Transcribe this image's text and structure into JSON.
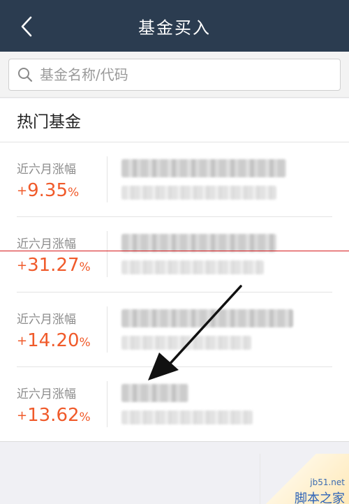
{
  "header": {
    "title": "基金买入",
    "back_icon": "chevron-left-icon"
  },
  "search": {
    "placeholder": "基金名称/代码",
    "value": "",
    "icon": "search-icon"
  },
  "section": {
    "title": "热门基金"
  },
  "funds": [
    {
      "label": "近六月涨幅",
      "sign": "+",
      "value": "9.35",
      "unit": "%"
    },
    {
      "label": "近六月涨幅",
      "sign": "+",
      "value": "31.27",
      "unit": "%"
    },
    {
      "label": "近六月涨幅",
      "sign": "+",
      "value": "14.20",
      "unit": "%"
    },
    {
      "label": "近六月涨幅",
      "sign": "+",
      "value": "13.62",
      "unit": "%"
    }
  ],
  "watermark": {
    "site": "jb51.net",
    "brand": "脚本之家"
  },
  "colors": {
    "header_bg": "#2b3c50",
    "gain": "#f05a2a",
    "page_bg": "#f0f0f4"
  }
}
